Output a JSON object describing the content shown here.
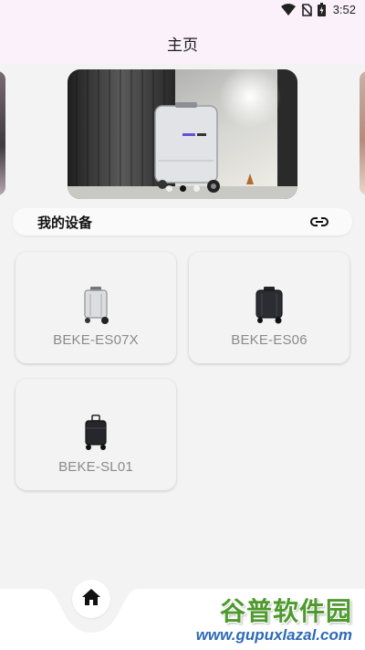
{
  "status_bar": {
    "time": "3:52",
    "icons": [
      "wifi-icon",
      "no-sim-icon",
      "battery-charging-icon"
    ]
  },
  "app_bar": {
    "title": "主页"
  },
  "carousel": {
    "slide_count": 3,
    "active_index": 1
  },
  "devices_section": {
    "title": "我的设备",
    "link_icon": "link-icon"
  },
  "devices": [
    {
      "name": "BEKE-ES07X",
      "image": "silver-suitcase-scooter"
    },
    {
      "name": "BEKE-ES06",
      "image": "black-suitcase-scooter"
    },
    {
      "name": "BEKE-SL01",
      "image": "black-suitcase-scooter-small"
    }
  ],
  "bottom_nav": {
    "items": [
      {
        "icon": "home-icon",
        "active": true
      }
    ]
  },
  "watermark": {
    "main": "谷普软件园",
    "sub": "www.gupuxlazal.com"
  },
  "colors": {
    "status_bar_bg": "#faf1fa",
    "page_bg": "#f3f3f3",
    "device_name": "#8a8a8a",
    "watermark_green": "#4e9a2e",
    "watermark_blue": "#2d6ab7"
  }
}
